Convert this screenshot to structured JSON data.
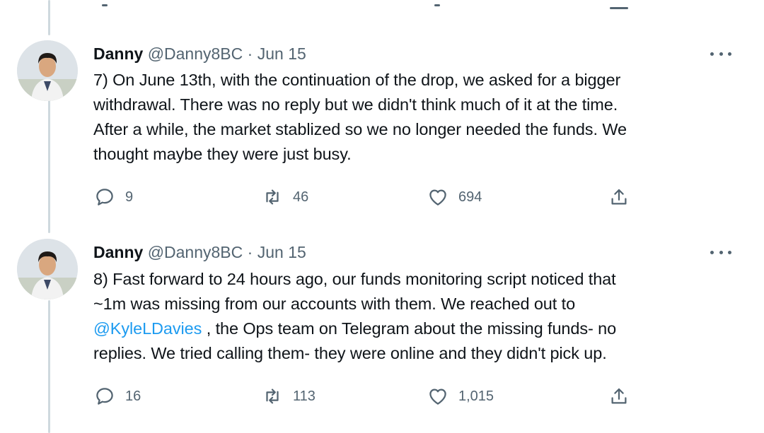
{
  "tweets": [
    {
      "author_name": "Danny",
      "handle": "@Danny8BC",
      "separator": "·",
      "date": "Jun 15",
      "text_lines": [
        "7) On June 13th, with the continuation of the drop, we asked for a bigger",
        "withdrawal. There was no reply but we didn't think much of it at the time.",
        "After a while, the market stablized so we no longer needed the funds. We",
        "thought maybe they were just busy."
      ],
      "actions": {
        "reply_count": "9",
        "retweet_count": "46",
        "like_count": "694"
      }
    },
    {
      "author_name": "Danny",
      "handle": "@Danny8BC",
      "separator": "·",
      "date": "Jun 15",
      "text_lines": [
        "8) Fast forward to 24 hours ago, our funds monitoring script noticed that",
        "~1m was missing from our accounts with them. We reached out to",
        ", the Ops team on Telegram about the missing funds- no",
        "replies. We tried calling them- they were online and they didn't pick up."
      ],
      "mention": "@KyleLDavies",
      "actions": {
        "reply_count": "16",
        "retweet_count": "113",
        "like_count": "1,015"
      }
    }
  ],
  "icons": {
    "reply": "reply-icon",
    "retweet": "retweet-icon",
    "like": "heart-icon",
    "share": "share-icon",
    "more": "more-options-icon"
  },
  "colors": {
    "text": "#0f1419",
    "secondary": "#536471",
    "link": "#1d9bf0",
    "thread_line": "#cfd9de"
  }
}
